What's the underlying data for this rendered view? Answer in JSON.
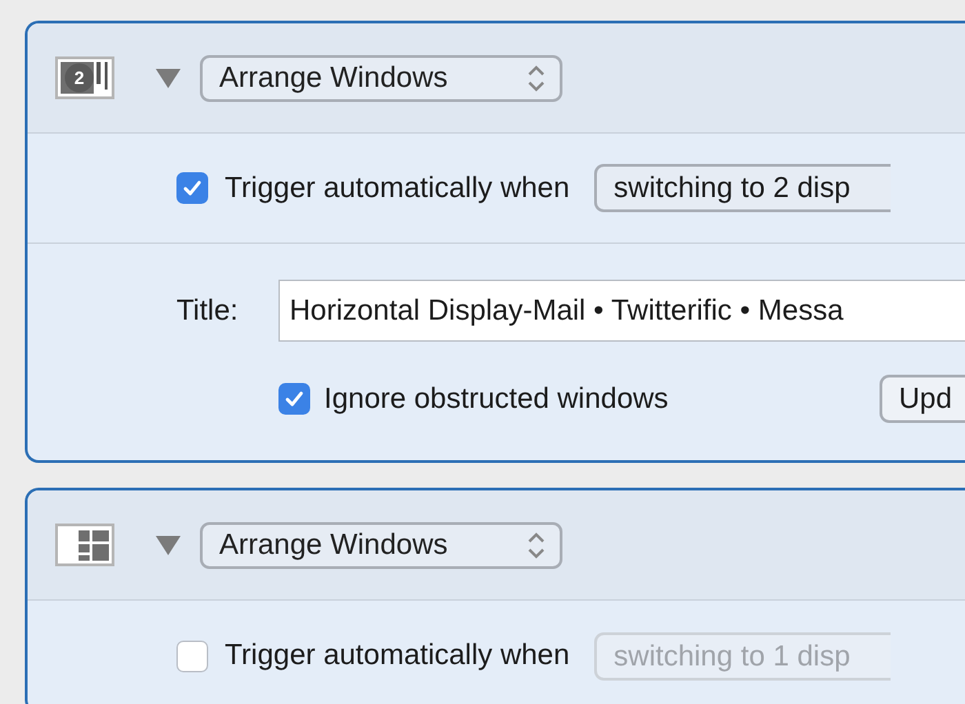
{
  "actions": [
    {
      "kind": "numbered",
      "badge": "2",
      "expanded": true,
      "menu": "Arrange Windows",
      "trigger": {
        "checked": true,
        "label": "Trigger automatically when",
        "condition": "switching to 2 disp"
      },
      "details": {
        "title_label": "Title:",
        "title_value": "Horizontal Display-Mail • Twitterific • Messa",
        "ignore": {
          "checked": true,
          "label": "Ignore obstructed windows"
        },
        "button": "Upd"
      }
    },
    {
      "kind": "tiles",
      "expanded": true,
      "menu": "Arrange Windows",
      "trigger": {
        "checked": false,
        "label": "Trigger automatically when",
        "condition": "switching to 1 disp"
      }
    }
  ]
}
